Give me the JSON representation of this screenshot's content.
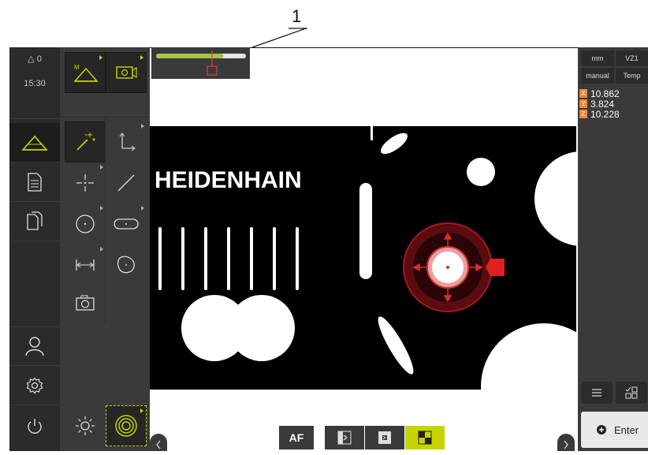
{
  "callout": {
    "number": "1"
  },
  "statusbar": {
    "warnings": "0",
    "time": "15:30",
    "items": [
      {
        "name": "measure-icon",
        "active": true
      },
      {
        "name": "protocol-icon"
      },
      {
        "name": "file-management-icon"
      },
      {
        "name": "user-login-icon"
      },
      {
        "name": "settings-icon"
      },
      {
        "name": "switch-off-icon"
      }
    ]
  },
  "image": {
    "brand_text": "HEIDENHAIN"
  },
  "slide_widget": {
    "level": 0.75
  },
  "right_panel": {
    "unit": "mm",
    "coord_system": "VZ1",
    "mode": "manual",
    "temp": "Temp",
    "axes": [
      {
        "axis": "X",
        "value": "10.862"
      },
      {
        "axis": "Y",
        "value": "3.824"
      },
      {
        "axis": "Z",
        "value": "10.228"
      }
    ],
    "enter_label": "Enter"
  },
  "bottom": {
    "af_label": "AF"
  },
  "colors": {
    "accent": "#c8d400",
    "axis": "#f0883a",
    "status_bg": "#2b2b2b",
    "palette_bg": "#3a3a3a"
  }
}
